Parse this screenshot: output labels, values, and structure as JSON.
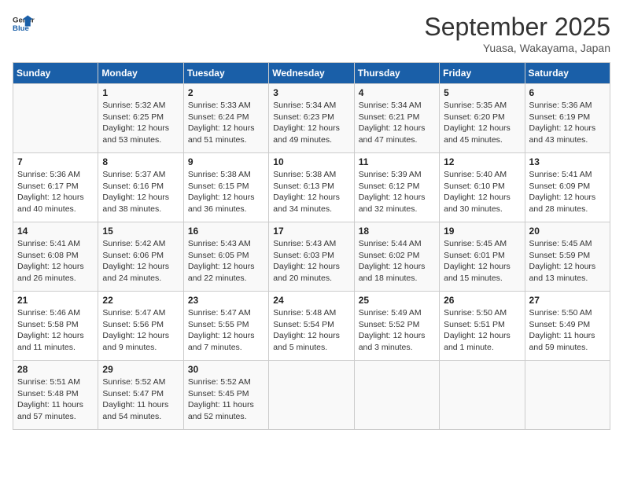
{
  "header": {
    "logo_line1": "General",
    "logo_line2": "Blue",
    "month": "September 2025",
    "location": "Yuasa, Wakayama, Japan"
  },
  "days_of_week": [
    "Sunday",
    "Monday",
    "Tuesday",
    "Wednesday",
    "Thursday",
    "Friday",
    "Saturday"
  ],
  "weeks": [
    [
      {
        "day": "",
        "info": ""
      },
      {
        "day": "1",
        "info": "Sunrise: 5:32 AM\nSunset: 6:25 PM\nDaylight: 12 hours\nand 53 minutes."
      },
      {
        "day": "2",
        "info": "Sunrise: 5:33 AM\nSunset: 6:24 PM\nDaylight: 12 hours\nand 51 minutes."
      },
      {
        "day": "3",
        "info": "Sunrise: 5:34 AM\nSunset: 6:23 PM\nDaylight: 12 hours\nand 49 minutes."
      },
      {
        "day": "4",
        "info": "Sunrise: 5:34 AM\nSunset: 6:21 PM\nDaylight: 12 hours\nand 47 minutes."
      },
      {
        "day": "5",
        "info": "Sunrise: 5:35 AM\nSunset: 6:20 PM\nDaylight: 12 hours\nand 45 minutes."
      },
      {
        "day": "6",
        "info": "Sunrise: 5:36 AM\nSunset: 6:19 PM\nDaylight: 12 hours\nand 43 minutes."
      }
    ],
    [
      {
        "day": "7",
        "info": "Sunrise: 5:36 AM\nSunset: 6:17 PM\nDaylight: 12 hours\nand 40 minutes."
      },
      {
        "day": "8",
        "info": "Sunrise: 5:37 AM\nSunset: 6:16 PM\nDaylight: 12 hours\nand 38 minutes."
      },
      {
        "day": "9",
        "info": "Sunrise: 5:38 AM\nSunset: 6:15 PM\nDaylight: 12 hours\nand 36 minutes."
      },
      {
        "day": "10",
        "info": "Sunrise: 5:38 AM\nSunset: 6:13 PM\nDaylight: 12 hours\nand 34 minutes."
      },
      {
        "day": "11",
        "info": "Sunrise: 5:39 AM\nSunset: 6:12 PM\nDaylight: 12 hours\nand 32 minutes."
      },
      {
        "day": "12",
        "info": "Sunrise: 5:40 AM\nSunset: 6:10 PM\nDaylight: 12 hours\nand 30 minutes."
      },
      {
        "day": "13",
        "info": "Sunrise: 5:41 AM\nSunset: 6:09 PM\nDaylight: 12 hours\nand 28 minutes."
      }
    ],
    [
      {
        "day": "14",
        "info": "Sunrise: 5:41 AM\nSunset: 6:08 PM\nDaylight: 12 hours\nand 26 minutes."
      },
      {
        "day": "15",
        "info": "Sunrise: 5:42 AM\nSunset: 6:06 PM\nDaylight: 12 hours\nand 24 minutes."
      },
      {
        "day": "16",
        "info": "Sunrise: 5:43 AM\nSunset: 6:05 PM\nDaylight: 12 hours\nand 22 minutes."
      },
      {
        "day": "17",
        "info": "Sunrise: 5:43 AM\nSunset: 6:03 PM\nDaylight: 12 hours\nand 20 minutes."
      },
      {
        "day": "18",
        "info": "Sunrise: 5:44 AM\nSunset: 6:02 PM\nDaylight: 12 hours\nand 18 minutes."
      },
      {
        "day": "19",
        "info": "Sunrise: 5:45 AM\nSunset: 6:01 PM\nDaylight: 12 hours\nand 15 minutes."
      },
      {
        "day": "20",
        "info": "Sunrise: 5:45 AM\nSunset: 5:59 PM\nDaylight: 12 hours\nand 13 minutes."
      }
    ],
    [
      {
        "day": "21",
        "info": "Sunrise: 5:46 AM\nSunset: 5:58 PM\nDaylight: 12 hours\nand 11 minutes."
      },
      {
        "day": "22",
        "info": "Sunrise: 5:47 AM\nSunset: 5:56 PM\nDaylight: 12 hours\nand 9 minutes."
      },
      {
        "day": "23",
        "info": "Sunrise: 5:47 AM\nSunset: 5:55 PM\nDaylight: 12 hours\nand 7 minutes."
      },
      {
        "day": "24",
        "info": "Sunrise: 5:48 AM\nSunset: 5:54 PM\nDaylight: 12 hours\nand 5 minutes."
      },
      {
        "day": "25",
        "info": "Sunrise: 5:49 AM\nSunset: 5:52 PM\nDaylight: 12 hours\nand 3 minutes."
      },
      {
        "day": "26",
        "info": "Sunrise: 5:50 AM\nSunset: 5:51 PM\nDaylight: 12 hours\nand 1 minute."
      },
      {
        "day": "27",
        "info": "Sunrise: 5:50 AM\nSunset: 5:49 PM\nDaylight: 11 hours\nand 59 minutes."
      }
    ],
    [
      {
        "day": "28",
        "info": "Sunrise: 5:51 AM\nSunset: 5:48 PM\nDaylight: 11 hours\nand 57 minutes."
      },
      {
        "day": "29",
        "info": "Sunrise: 5:52 AM\nSunset: 5:47 PM\nDaylight: 11 hours\nand 54 minutes."
      },
      {
        "day": "30",
        "info": "Sunrise: 5:52 AM\nSunset: 5:45 PM\nDaylight: 11 hours\nand 52 minutes."
      },
      {
        "day": "",
        "info": ""
      },
      {
        "day": "",
        "info": ""
      },
      {
        "day": "",
        "info": ""
      },
      {
        "day": "",
        "info": ""
      }
    ]
  ]
}
